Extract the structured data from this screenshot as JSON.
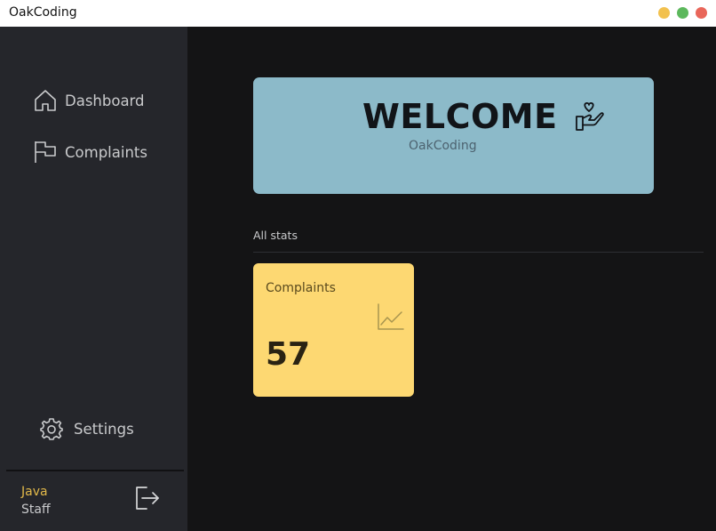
{
  "window": {
    "title": "OakCoding",
    "controls": {
      "minimize_color": "#f2c14e",
      "maximize_color": "#5cb85c",
      "close_color": "#e9665a"
    }
  },
  "sidebar": {
    "items": [
      {
        "label": "Dashboard",
        "icon": "home-icon"
      },
      {
        "label": "Complaints",
        "icon": "flag-icon"
      }
    ],
    "settings": {
      "label": "Settings",
      "icon": "gear-icon"
    },
    "user": {
      "role": "Java",
      "department": "Staff",
      "role_color": "#e2b94a"
    },
    "logout_icon": "logout-icon"
  },
  "main": {
    "welcome": {
      "title": "WELCOME",
      "subtitle": "OakCoding",
      "icon": "hand-heart-icon",
      "bg_color": "#8cbac9"
    },
    "section_title": "All stats",
    "stats": [
      {
        "label": "Complaints",
        "value": "57",
        "icon": "chart-line-icon",
        "bg_color": "#fdd872"
      }
    ]
  }
}
